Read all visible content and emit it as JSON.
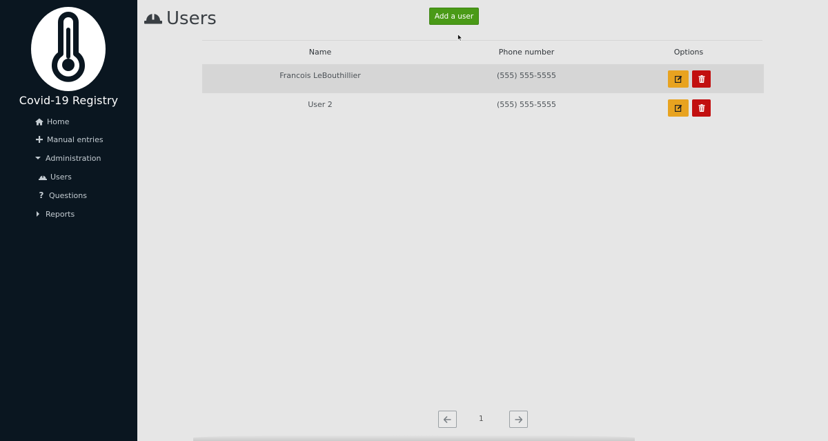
{
  "app": {
    "title": "Covid-19 Registry"
  },
  "nav": {
    "items": [
      {
        "label": "Home",
        "icon": "home-icon"
      },
      {
        "label": "Manual entries",
        "icon": "plus-icon"
      },
      {
        "label": "Administration",
        "icon": "caret-down-icon"
      },
      {
        "label": "Users",
        "icon": "hard-hat-icon"
      },
      {
        "label": "Questions",
        "icon": "question-icon"
      },
      {
        "label": "Reports",
        "icon": "caret-right-icon"
      }
    ]
  },
  "page": {
    "title": "Users",
    "icon": "hard-hat-icon"
  },
  "toolbar": {
    "add_label": "Add a user"
  },
  "table": {
    "columns": [
      "Name",
      "Phone number",
      "Options"
    ],
    "rows": [
      {
        "name": "Francois LeBouthillier",
        "phone": "(555) 555-5555"
      },
      {
        "name": "User 2",
        "phone": "(555) 555-5555"
      }
    ]
  },
  "pagination": {
    "current_page": "1"
  },
  "colors": {
    "sidebar_bg": "#0a1620",
    "add_button": "#4a9a17",
    "edit_button": "#e8a320",
    "delete_button": "#c20f0f"
  }
}
